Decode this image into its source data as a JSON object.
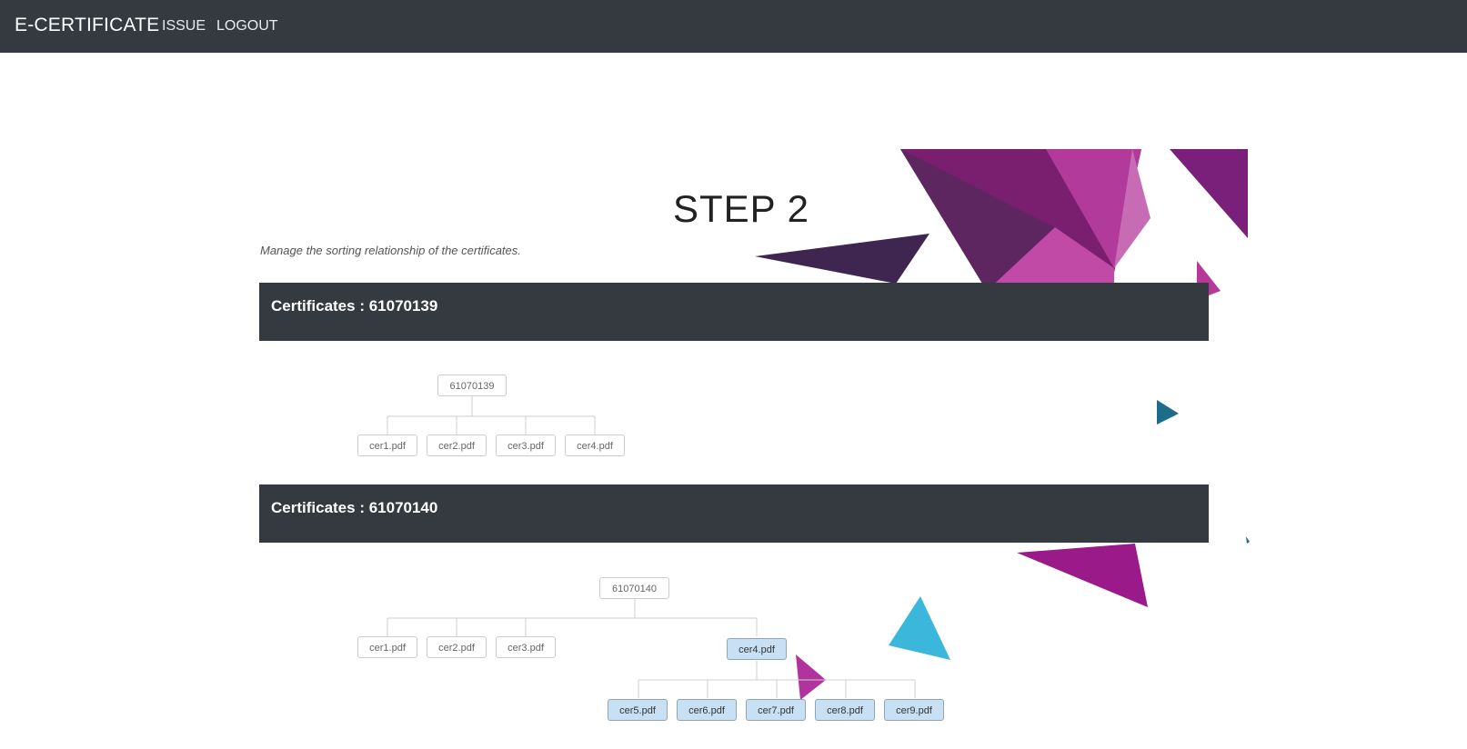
{
  "navbar": {
    "brand": "E-CERTIFICATE",
    "links": [
      "ISSUE",
      "LOGOUT"
    ]
  },
  "page": {
    "title": "STEP 2",
    "subtitle": "Manage the sorting relationship of the certificates."
  },
  "sections": [
    {
      "header": "Certificates : 61070139",
      "root": "61070139",
      "children": [
        "cer1.pdf",
        "cer2.pdf",
        "cer3.pdf",
        "cer4.pdf"
      ]
    },
    {
      "header": "Certificates : 61070140",
      "root": "61070140",
      "children": [
        "cer1.pdf",
        "cer2.pdf",
        "cer3.pdf",
        "cer4.pdf"
      ],
      "grandchildren": [
        "cer5.pdf",
        "cer6.pdf",
        "cer7.pdf",
        "cer8.pdf",
        "cer9.pdf"
      ]
    }
  ],
  "colors": {
    "navbar": "#343a40",
    "node_selected": "#c8e0f4",
    "accent_purple": "#8e1b7c",
    "accent_blue": "#3ab7db"
  }
}
